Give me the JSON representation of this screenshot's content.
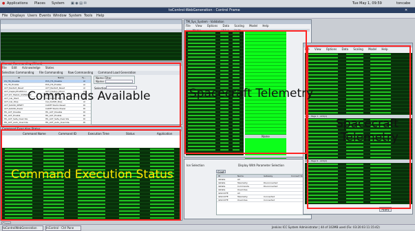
{
  "topbar": {
    "applications": "Applications",
    "places": "Places",
    "system": "System",
    "clock": "Tue May 1, 09:59",
    "user": "toncabe"
  },
  "titlebar": {
    "title": "toControl-WebGeneration - Control Frame"
  },
  "menubar": {
    "items": [
      "File",
      "Displays",
      "Users",
      "Events",
      "Window",
      "System",
      "Tools",
      "Help"
    ]
  },
  "windows": {
    "commanding": {
      "title": "Manual Commanding (Rfeed)",
      "menu": [
        "File",
        "Edit",
        "Acknowledge",
        "States"
      ],
      "tabs": [
        "Selection Commanding",
        "File Commanding",
        "Raw Commanding",
        "Command Load Generation"
      ],
      "columns": [
        "ID",
        "Name",
        "Ty..."
      ],
      "rows": [
        [
          "CS_HS_Disable",
          "PCS_HS_Disable",
          "AI"
        ],
        [
          "CS_HS_Enable",
          "PCS_HS_Enable",
          "AI"
        ],
        [
          "ACT_Restart_Reset",
          "ACT_Restart_Reset",
          "AI"
        ],
        [
          "ACT_DeployFirstMirror",
          "ACT_Deploy_Mirror",
          "AI"
        ],
        [
          "ACT_RT_TRACK_OVERRIDE",
          "ACT_RT_Track",
          "DI"
        ],
        [
          "ACT_Cal_Start",
          "Cal_CLOSE_Start",
          "AI"
        ],
        [
          "ACT_Cal_Stop",
          "Cal_CLOSE_Stop",
          "AI"
        ],
        [
          "ACT_RADIO_RESET",
          "CADET Radio Reset",
          "DI"
        ],
        [
          "ACT_RADIO_Power",
          "CADET Radio Power",
          "DI"
        ],
        [
          "HK_ACT_Disable",
          "HK_ACT_Disable",
          "DI"
        ],
        [
          "HK_ACT_Enable",
          "HK_ACT_Enable",
          "DI"
        ],
        [
          "HK_ACT_Safe_Override",
          "HK_ACT_Safe_Override",
          "DI"
        ],
        [
          "HK_ACT_Auto_Override",
          "HK_ACT_Auto_Override",
          "DI"
        ]
      ],
      "name_filter": "Name Filter",
      "name_label": "Name:",
      "selection_label": "Selection:"
    },
    "exec_status": {
      "title": "Command Execution Status",
      "columns": [
        "Command Name",
        "Command ID",
        "Execution Time",
        "Status",
        "Application"
      ]
    },
    "telemetry": {
      "title": "TM_Sys_System - Validation",
      "menu": [
        "File",
        "View",
        "Options",
        "Data",
        "Scaling",
        "Model",
        "Help"
      ],
      "columns": [
        "Name",
        "Value",
        "Units"
      ],
      "bottom_label": "Name"
    },
    "telemetry2": {
      "menu": [
        "File",
        "View",
        "Options",
        "Data",
        "Scaling",
        "Model",
        "Help"
      ],
      "page_a": "ACS - Page 1 - ACS(1)",
      "page_b": "ACS - Page 6 - ACS(2)"
    },
    "connection": {
      "selection": "Ion Selection",
      "display": "Display With Parameter Selection",
      "tab": "Conf",
      "columns": [
        "ID",
        "Name",
        "Gateway",
        "Connect Status"
      ],
      "rows": [
        [
          "ilsData",
          "All",
          "",
          ""
        ],
        [
          "ilsData",
          "Telemetry",
          "Disconnected",
          ""
        ],
        [
          "ilsData",
          "Commands",
          "Disconnected",
          ""
        ],
        [
          "ilsData",
          "Overrides",
          "",
          ""
        ],
        [
          "ilsSimCFE",
          "All",
          "",
          ""
        ],
        [
          "ilsSimCFE",
          "Telemetry",
          "Connected",
          ""
        ],
        [
          "ilsSimCFE",
          "Overrides",
          "Connected",
          ""
        ]
      ]
    }
  },
  "labels": {
    "commands_available": "Commands Available",
    "command_execution_status": "Command Execution Status",
    "spacecraft_telemetry": "Spacecraft Telemetry",
    "spacecraft_telemetry_right_line1": "Spacecraft",
    "spacecraft_telemetry_right_line2": "Telemetry"
  },
  "buttons": {
    "apply": "Apply",
    "close": "Close"
  },
  "statusbar": {
    "task1": "toControlWebGeneration",
    "task2": "InControl - Ctrl Pane",
    "right": "Jenkins ICC System Administrator | 44 of 102MB used (Fix: 03:20:03 11:15:42)"
  }
}
